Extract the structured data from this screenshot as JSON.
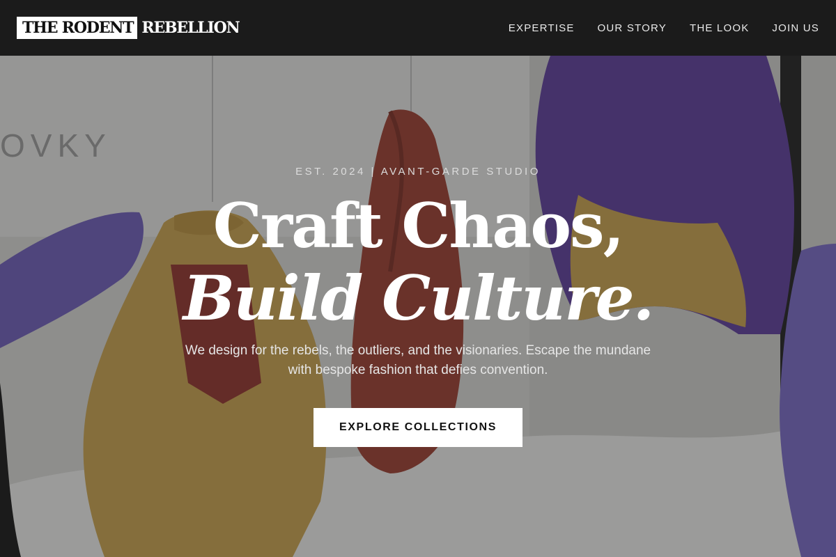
{
  "brand": {
    "boxed": "THE RODENT",
    "rest": "REBELLION"
  },
  "nav": {
    "items": [
      "EXPERTISE",
      "OUR STORY",
      "THE LOOK",
      "JOIN US"
    ]
  },
  "hero": {
    "eyebrow": "EST. 2024 | AVANT-GARDE STUDIO",
    "headline_line1": "Craft Chaos,",
    "headline_line2": "Build Culture.",
    "lede": "We design for the rebels, the outliers, and the visionaries. Escape the mundane with bespoke fashion that defies convention.",
    "cta_label": "EXPLORE COLLECTIONS",
    "wall_text": "OVKY"
  },
  "colors": {
    "nav_bg": "#1b1b1b",
    "cta_bg": "#ffffff",
    "yellow": "#c9a04a",
    "red": "#9a3a2c",
    "purple": "#5a3a9a"
  }
}
